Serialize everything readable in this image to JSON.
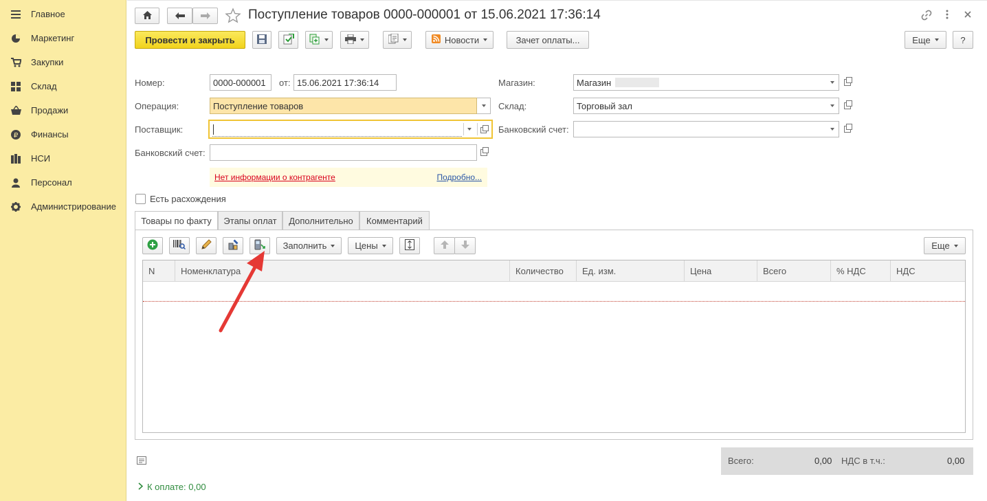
{
  "sidebar": {
    "items": [
      {
        "label": "Главное",
        "icon": "menu-icon"
      },
      {
        "label": "Маркетинг",
        "icon": "pie-chart-icon"
      },
      {
        "label": "Закупки",
        "icon": "cart-icon"
      },
      {
        "label": "Склад",
        "icon": "grid-icon"
      },
      {
        "label": "Продажи",
        "icon": "basket-icon"
      },
      {
        "label": "Финансы",
        "icon": "ruble-icon"
      },
      {
        "label": "НСИ",
        "icon": "books-icon"
      },
      {
        "label": "Персонал",
        "icon": "person-icon"
      },
      {
        "label": "Администрирование",
        "icon": "gear-icon"
      }
    ]
  },
  "window": {
    "title": "Поступление товаров 0000-000001 от 15.06.2021 17:36:14"
  },
  "toolbar": {
    "post_close": "Провести и закрыть",
    "news": "Новости",
    "payment_offset": "Зачет оплаты...",
    "more": "Еще",
    "help": "?"
  },
  "form": {
    "number_label": "Номер:",
    "number_value": "0000-000001",
    "date_label": "от:",
    "date_value": "15.06.2021 17:36:14",
    "operation_label": "Операция:",
    "operation_value": "Поступление товаров",
    "supplier_label": "Поставщик:",
    "supplier_value": "",
    "bank_account_label": "Банковский счет:",
    "bank_account_value": "",
    "store_label": "Магазин:",
    "store_value": "Магазин",
    "warehouse_label": "Склад:",
    "warehouse_value": "Торговый зал",
    "bank_account2_label": "Банковский счет:",
    "bank_account2_value": "",
    "no_info": "Нет информации о контрагенте",
    "details": "Подробно...",
    "discrepancy_label": "Есть расхождения"
  },
  "tabs": [
    {
      "label": "Товары по факту"
    },
    {
      "label": "Этапы оплат"
    },
    {
      "label": "Дополнительно"
    },
    {
      "label": "Комментарий"
    }
  ],
  "table_toolbar": {
    "fill": "Заполнить",
    "prices": "Цены",
    "more": "Еще"
  },
  "table": {
    "columns": [
      "N",
      "Номенклатура",
      "Количество",
      "Ед. изм.",
      "Цена",
      "Всего",
      "% НДС",
      "НДС"
    ]
  },
  "totals": {
    "total_label": "Всего:",
    "total_value": "0,00",
    "vat_label": "НДС в т.ч.:",
    "vat_value": "0,00"
  },
  "footer": {
    "to_pay": "К оплате: 0,00"
  },
  "colors": {
    "sidebar_bg": "#fbeca4",
    "primary_button": "#f1d31c",
    "operation_field": "#fde5a9",
    "warning_text": "#d9001b",
    "arrow": "#e53935"
  }
}
